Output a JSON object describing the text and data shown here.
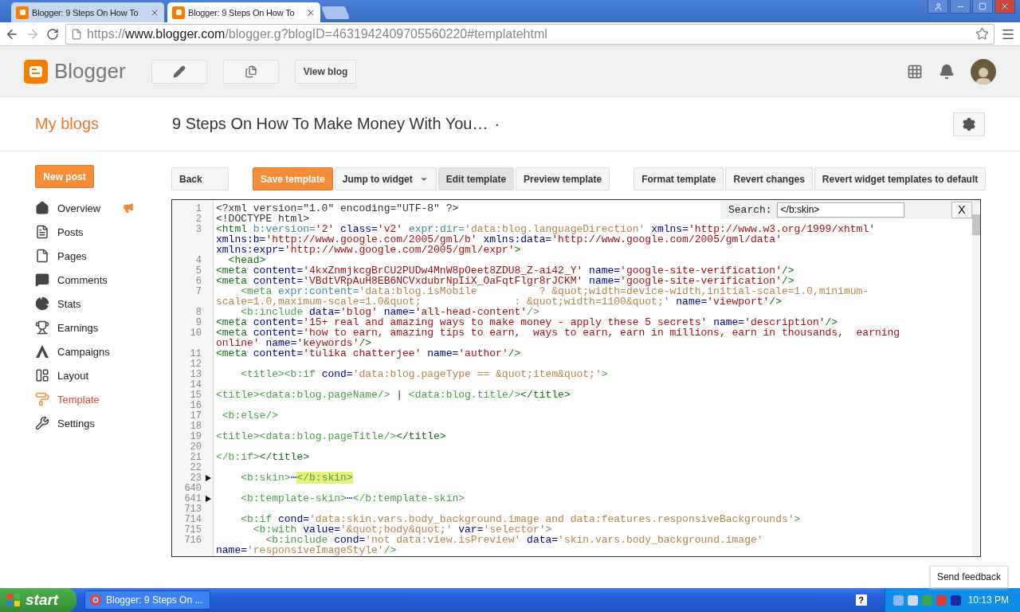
{
  "browser": {
    "tabs": [
      {
        "title": "Blogger: 9 Steps On How To",
        "selected": false
      },
      {
        "title": "Blogger: 9 Steps On How To",
        "selected": true
      }
    ],
    "url": {
      "scheme": "https://",
      "host": "www.blogger.com",
      "path": "/blogger.g?blogID=4631942409705560220#templatehtml"
    }
  },
  "header": {
    "logo": "Blogger",
    "view_blog": "View blog"
  },
  "title_bar": {
    "my_blogs": "My blogs",
    "blog_title": "9 Steps On How To Make Money With You…",
    "menu_dot": "·"
  },
  "sidebar": {
    "new_post": "New post",
    "items": [
      {
        "label": "Overview",
        "selected": false,
        "notice": true
      },
      {
        "label": "Posts",
        "selected": false,
        "notice": false
      },
      {
        "label": "Pages",
        "selected": false,
        "notice": false
      },
      {
        "label": "Comments",
        "selected": false,
        "notice": false
      },
      {
        "label": "Stats",
        "selected": false,
        "notice": false
      },
      {
        "label": "Earnings",
        "selected": false,
        "notice": false
      },
      {
        "label": "Campaigns",
        "selected": false,
        "notice": false
      },
      {
        "label": "Layout",
        "selected": false,
        "notice": false
      },
      {
        "label": "Template",
        "selected": true,
        "notice": false
      },
      {
        "label": "Settings",
        "selected": false,
        "notice": false
      }
    ]
  },
  "toolbar": {
    "groups": [
      {
        "buttons": [
          {
            "label": "Back",
            "kind": "plain",
            "selected": false
          }
        ]
      },
      {
        "buttons": [
          {
            "label": "Save template",
            "kind": "primary",
            "selected": false
          },
          {
            "label": "Jump to widget",
            "kind": "dropdown",
            "selected": false
          },
          {
            "label": "Edit template",
            "kind": "plain",
            "selected": true
          },
          {
            "label": "Preview template",
            "kind": "plain",
            "selected": false
          }
        ]
      },
      {
        "buttons": [
          {
            "label": "Format template",
            "kind": "plain",
            "selected": false
          },
          {
            "label": "Revert changes",
            "kind": "plain",
            "selected": false
          },
          {
            "label": "Revert widget templates to default",
            "kind": "plain",
            "selected": false
          }
        ]
      }
    ]
  },
  "editor": {
    "search": {
      "label": "Search:",
      "value": "</b:skin>",
      "close": "X"
    },
    "lines": [
      {
        "number": "1",
        "foldable": false,
        "rows": [
          {
            "parts": [
              {
                "kind": "text",
                "text": "<?xml version=\"1.0\" encoding=\"UTF-8\" ?>"
              }
            ]
          }
        ]
      },
      {
        "number": "2",
        "foldable": false,
        "rows": [
          {
            "parts": [
              {
                "kind": "text",
                "text": "<!DOCTYPE html>"
              }
            ]
          }
        ]
      },
      {
        "number": "3",
        "foldable": false,
        "rows": [
          {
            "parts": [
              {
                "kind": "tag",
                "text": "<html "
              },
              {
                "kind": "nsattr",
                "text": "b:version="
              },
              {
                "kind": "value",
                "text": "'2' "
              },
              {
                "kind": "attr",
                "text": "class="
              },
              {
                "kind": "value",
                "text": "'v2' "
              },
              {
                "kind": "nsattr",
                "text": "expr:dir="
              },
              {
                "kind": "bvalue",
                "text": "'data:blog.languageDirection' "
              },
              {
                "kind": "attr",
                "text": "xmlns="
              },
              {
                "kind": "value",
                "text": "'http://www.w3.org/1999/xhtml'"
              }
            ]
          },
          {
            "parts": [
              {
                "kind": "attr",
                "text": "xmlns:b="
              },
              {
                "kind": "value",
                "text": "'http://www.google.com/2005/gml/b' "
              },
              {
                "kind": "attr",
                "text": "xmlns:data="
              },
              {
                "kind": "value",
                "text": "'http://www.google.com/2005/gml/data'"
              }
            ]
          },
          {
            "parts": [
              {
                "kind": "attr",
                "text": "xmlns:expr="
              },
              {
                "kind": "value",
                "text": "'http://www.google.com/2005/gml/expr'"
              },
              {
                "kind": "tag",
                "text": ">"
              }
            ]
          }
        ]
      },
      {
        "number": "4",
        "foldable": false,
        "rows": [
          {
            "parts": [
              {
                "kind": "tag",
                "text": "  <head>"
              }
            ]
          }
        ]
      },
      {
        "number": "5",
        "foldable": false,
        "rows": [
          {
            "parts": [
              {
                "kind": "tag",
                "text": "<meta "
              },
              {
                "kind": "attr",
                "text": "content="
              },
              {
                "kind": "value",
                "text": "'4kxZnmjkcgBrCU2PUDw4MnW8pOeet8ZDU8_Z-ai42_Y' "
              },
              {
                "kind": "attr",
                "text": "name="
              },
              {
                "kind": "value",
                "text": "'google-site-verification'"
              },
              {
                "kind": "tag",
                "text": "/>"
              }
            ]
          }
        ]
      },
      {
        "number": "6",
        "foldable": false,
        "rows": [
          {
            "parts": [
              {
                "kind": "tag",
                "text": "<meta "
              },
              {
                "kind": "attr",
                "text": "content="
              },
              {
                "kind": "value",
                "text": "'VBdtVRpAuH8EB6NCVxdubrNpIiX_OaFqtFlgr8rJCKM' "
              },
              {
                "kind": "attr",
                "text": "name="
              },
              {
                "kind": "value",
                "text": "'google-site-verification'"
              },
              {
                "kind": "tag",
                "text": "/>"
              }
            ]
          }
        ]
      },
      {
        "number": "7",
        "foldable": false,
        "rows": [
          {
            "parts": [
              {
                "kind": "btag",
                "text": "    <meta "
              },
              {
                "kind": "nsattr",
                "text": "expr:content="
              },
              {
                "kind": "bvalue",
                "text": "'data:blog.isMobile          ? &quot;width=device-width,initial-scale=1.0,minimum-"
              }
            ]
          },
          {
            "parts": [
              {
                "kind": "bvalue",
                "text": "scale=1.0,maximum-scale=1.0&quot;               : &quot;width=1100&quot;' "
              },
              {
                "kind": "attr",
                "text": "name="
              },
              {
                "kind": "value",
                "text": "'viewport'"
              },
              {
                "kind": "tag",
                "text": "/>"
              }
            ]
          }
        ]
      },
      {
        "number": "8",
        "foldable": false,
        "rows": [
          {
            "parts": [
              {
                "kind": "btag",
                "text": "    <b:include "
              },
              {
                "kind": "attr",
                "text": "data="
              },
              {
                "kind": "value",
                "text": "'blog' "
              },
              {
                "kind": "attr",
                "text": "name="
              },
              {
                "kind": "value",
                "text": "'all-head-content'"
              },
              {
                "kind": "btag",
                "text": "/>"
              }
            ]
          }
        ]
      },
      {
        "number": "9",
        "foldable": false,
        "rows": [
          {
            "parts": [
              {
                "kind": "tag",
                "text": "<meta "
              },
              {
                "kind": "attr",
                "text": "content="
              },
              {
                "kind": "value",
                "text": "'15+ real and amazing ways to make money - apply these 5 secrets' "
              },
              {
                "kind": "attr",
                "text": "name="
              },
              {
                "kind": "value",
                "text": "'description'"
              },
              {
                "kind": "tag",
                "text": "/>"
              }
            ]
          }
        ]
      },
      {
        "number": "10",
        "foldable": false,
        "rows": [
          {
            "parts": [
              {
                "kind": "tag",
                "text": "<meta "
              },
              {
                "kind": "attr",
                "text": "content="
              },
              {
                "kind": "value",
                "text": "'how to earn, amazing tips to earn,  ways to earn, earn in millions, earn in thousands,  earning"
              }
            ]
          },
          {
            "parts": [
              {
                "kind": "value",
                "text": "online' "
              },
              {
                "kind": "attr",
                "text": "name="
              },
              {
                "kind": "value",
                "text": "'keywords'"
              },
              {
                "kind": "tag",
                "text": "/>"
              }
            ]
          }
        ]
      },
      {
        "number": "11",
        "foldable": false,
        "rows": [
          {
            "parts": [
              {
                "kind": "tag",
                "text": "<meta "
              },
              {
                "kind": "attr",
                "text": "content="
              },
              {
                "kind": "value",
                "text": "'tulika chatterjee' "
              },
              {
                "kind": "attr",
                "text": "name="
              },
              {
                "kind": "value",
                "text": "'author'"
              },
              {
                "kind": "tag",
                "text": "/>"
              }
            ]
          }
        ]
      },
      {
        "number": "12",
        "foldable": false
      },
      {
        "number": "13",
        "foldable": false,
        "rows": [
          {
            "parts": [
              {
                "kind": "btag",
                "text": "    <title><b:if "
              },
              {
                "kind": "attr",
                "text": "cond="
              },
              {
                "kind": "bvalue",
                "text": "'data:blog.pageType == &quot;item&quot;'"
              },
              {
                "kind": "btag",
                "text": ">"
              }
            ]
          }
        ]
      },
      {
        "number": "14",
        "foldable": false
      },
      {
        "number": "15",
        "foldable": false,
        "rows": [
          {
            "parts": [
              {
                "kind": "btag",
                "text": "<title><data:blog.pageName/> "
              },
              {
                "kind": "text",
                "text": "| "
              },
              {
                "kind": "btag",
                "text": "<data:blog.title/>"
              },
              {
                "kind": "tag",
                "text": "</title>"
              }
            ]
          }
        ]
      },
      {
        "number": "16",
        "foldable": false
      },
      {
        "number": "17",
        "foldable": false,
        "rows": [
          {
            "parts": [
              {
                "kind": "btag",
                "text": " <b:else/>"
              }
            ]
          }
        ]
      },
      {
        "number": "18",
        "foldable": false
      },
      {
        "number": "19",
        "foldable": false,
        "rows": [
          {
            "parts": [
              {
                "kind": "btag",
                "text": "<title><data:blog.pageTitle/>"
              },
              {
                "kind": "tag",
                "text": "</title>"
              }
            ]
          }
        ]
      },
      {
        "number": "20",
        "foldable": false
      },
      {
        "number": "21",
        "foldable": false,
        "rows": [
          {
            "parts": [
              {
                "kind": "btag",
                "text": "</b:if>"
              },
              {
                "kind": "tag",
                "text": "</title>"
              }
            ]
          }
        ]
      },
      {
        "number": "22",
        "foldable": false
      },
      {
        "number": "23",
        "foldable": true,
        "rows": [
          {
            "parts": [
              {
                "kind": "btag",
                "text": "    <b:skin>"
              },
              {
                "kind": "fold",
                "text": "⋯"
              },
              {
                "kind": "match",
                "text": "</b:skin>"
              }
            ]
          }
        ]
      },
      {
        "number": "640",
        "foldable": false
      },
      {
        "number": "641",
        "foldable": true,
        "rows": [
          {
            "parts": [
              {
                "kind": "btag",
                "text": "    <b:template-skin>"
              },
              {
                "kind": "fold",
                "text": "⋯"
              },
              {
                "kind": "btag",
                "text": "</b:template-skin>"
              }
            ]
          }
        ]
      },
      {
        "number": "713",
        "foldable": false
      },
      {
        "number": "714",
        "foldable": false,
        "rows": [
          {
            "parts": [
              {
                "kind": "btag",
                "text": "    <b:if "
              },
              {
                "kind": "attr",
                "text": "cond="
              },
              {
                "kind": "bvalue",
                "text": "'data:skin.vars.body_background.image and data:features.responsiveBackgrounds'"
              },
              {
                "kind": "btag",
                "text": ">"
              }
            ]
          }
        ]
      },
      {
        "number": "715",
        "foldable": false,
        "rows": [
          {
            "parts": [
              {
                "kind": "btag",
                "text": "      <b:with "
              },
              {
                "kind": "attr",
                "text": "value="
              },
              {
                "kind": "bvalue",
                "text": "'&quot;body&quot;' "
              },
              {
                "kind": "attr",
                "text": "var="
              },
              {
                "kind": "bvalue",
                "text": "'selector'"
              },
              {
                "kind": "btag",
                "text": ">"
              }
            ]
          }
        ]
      },
      {
        "number": "716",
        "foldable": false,
        "rows": [
          {
            "parts": [
              {
                "kind": "btag",
                "text": "        <b:include "
              },
              {
                "kind": "attr",
                "text": "cond="
              },
              {
                "kind": "bvalue",
                "text": "'not data:view.isPreview' "
              },
              {
                "kind": "attr",
                "text": "data="
              },
              {
                "kind": "bvalue",
                "text": "'skin.vars.body_background.image'"
              }
            ]
          },
          {
            "parts": [
              {
                "kind": "attr",
                "text": "name="
              },
              {
                "kind": "bvalue",
                "text": "'responsiveImageStyle'"
              },
              {
                "kind": "btag",
                "text": "/>"
              }
            ]
          }
        ]
      }
    ]
  },
  "feedback": "Send feedback",
  "taskbar": {
    "start": "start",
    "task": "Blogger: 9 Steps On ...",
    "help": "?",
    "time": "10:13 PM"
  }
}
